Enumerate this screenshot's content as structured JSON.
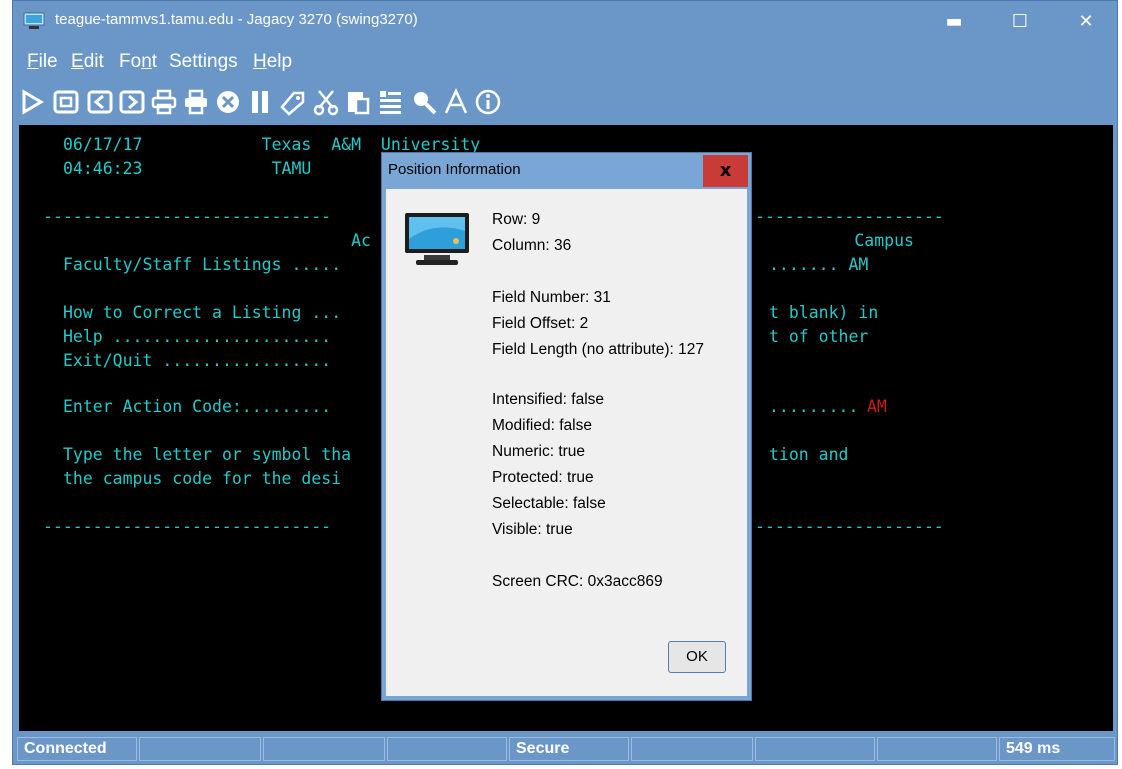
{
  "window": {
    "title": "teague-tammvs1.tamu.edu - Jagacy 3270 (swing3270)",
    "minimize_symbol": "▬",
    "maximize_symbol": "☐",
    "close_symbol": "✕"
  },
  "menubar": {
    "items": [
      {
        "prefix": "",
        "underlined": "F",
        "suffix": "ile"
      },
      {
        "prefix": "",
        "underlined": "E",
        "suffix": "dit"
      },
      {
        "prefix": "Fo",
        "underlined": "n",
        "suffix": "t"
      },
      {
        "prefix": "",
        "underlined": "",
        "suffix": "Settings"
      },
      {
        "prefix": "",
        "underlined": "H",
        "suffix": "elp"
      }
    ]
  },
  "toolbar": {
    "icons": [
      "play-icon",
      "stop-icon",
      "back-icon",
      "forward-icon",
      "print-icon",
      "printer-settings-icon",
      "cancel-icon",
      "pause-icon",
      "tag-icon",
      "cut-icon",
      "paste-icon",
      "list-icon",
      "search-icon",
      "font-icon",
      "info-icon"
    ]
  },
  "terminal": {
    "lines": [
      "06/17/17            Texas  A&M  University",
      "04:46:23             TAMU",
      "-----------------------------",
      "                             Ac",
      "Faculty/Staff Listings .....",
      "How to Correct a Listing ...",
      "Help ......................",
      "Exit/Quit .................",
      "Enter Action Code:.........",
      "Type the letter or symbol tha",
      "the campus code for the desi",
      "-----------------------------",
      "-------------------",
      "          Campus",
      "....... AM",
      "t blank) in",
      "t of other",
      ".........",
      "tion and",
      "-------------------"
    ],
    "action_code_value": "AM"
  },
  "dialog": {
    "title": "Position Information",
    "close_label": "x",
    "row": "Row: 9",
    "column": "Column: 36",
    "field_number": "Field Number: 31",
    "field_offset": "Field Offset: 2",
    "field_length": "Field Length (no attribute): 127",
    "intensified": "Intensified: false",
    "modified": "Modified: false",
    "numeric": "Numeric: true",
    "protected": "Protected: true",
    "selectable": "Selectable: false",
    "visible": "Visible: true",
    "screen_crc": "Screen CRC: 0x3acc869",
    "ok_label": "OK"
  },
  "statusbar": {
    "connection": "Connected",
    "security": "Secure",
    "latency": "549 ms",
    "empty": ""
  },
  "colors": {
    "window_blue": "#6b97c8",
    "terminal_text": "#26c9c9",
    "terminal_highlight": "#cc1b1b",
    "terminal_background": "#000000"
  }
}
